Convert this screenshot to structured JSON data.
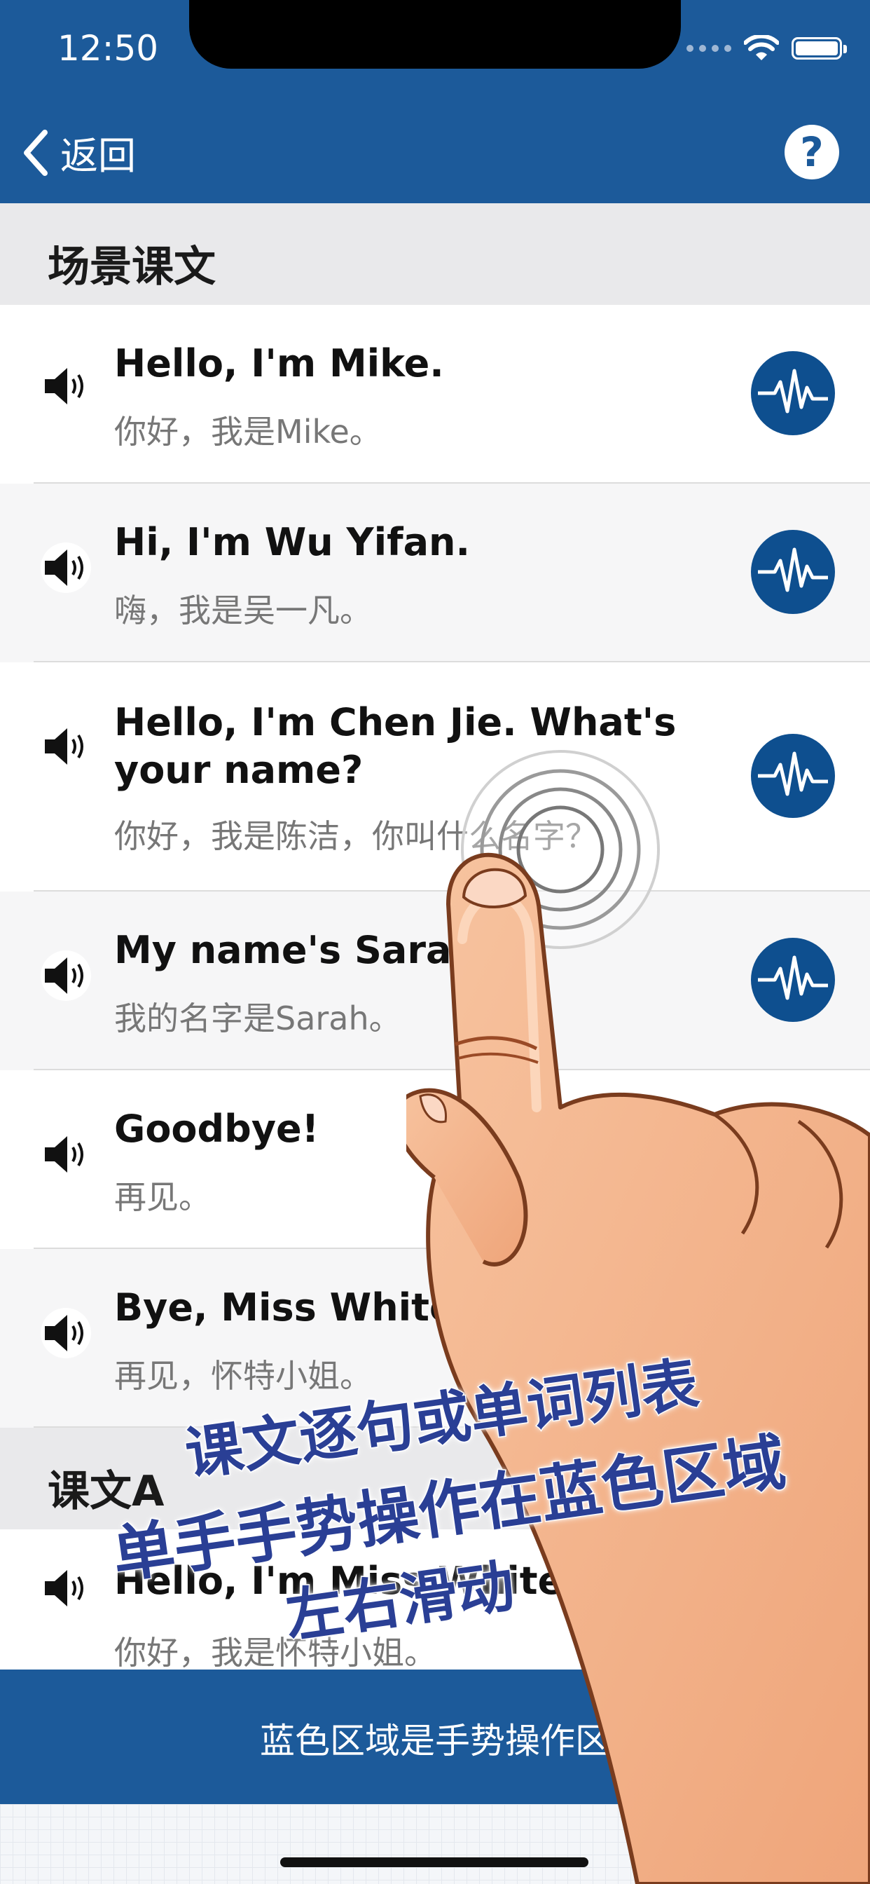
{
  "status_bar": {
    "time": "12:50",
    "wifi_icon": "wifi-icon",
    "battery_icon": "battery-icon"
  },
  "nav": {
    "back_label": "返回",
    "back_icon": "chevron-left-icon",
    "help_label": "?"
  },
  "sections": [
    {
      "title": "场景课文"
    },
    {
      "title": "课文A"
    }
  ],
  "rows": [
    {
      "en": "Hello, I'm Mike.",
      "zh": "你好，我是Mike。"
    },
    {
      "en": "Hi, I'm Wu Yifan.",
      "zh": "嗨，我是吴一凡。"
    },
    {
      "en": "Hello, I'm Chen Jie. What's your name?",
      "zh": "你好，我是陈洁，你叫什么名字？"
    },
    {
      "en": "My name's Sarah.",
      "zh": "我的名字是Sarah。"
    },
    {
      "en": "Goodbye!",
      "zh": "再见。"
    },
    {
      "en": "Bye, Miss White!",
      "zh": "再见，怀特小姐。"
    },
    {
      "en": "Hello, I'm Miss White.",
      "zh": "你好，我是怀特小姐。"
    }
  ],
  "gesture_bar": {
    "label": "蓝色区域是手势操作区"
  },
  "caption": {
    "line1": "课文逐句或单词列表",
    "line2": "单手手势操作在蓝色区域",
    "line3": "左右滑动"
  },
  "colors": {
    "primary": "#1c5a9a",
    "wave_button": "#0e4f8f",
    "caption": "#2a3f95"
  }
}
